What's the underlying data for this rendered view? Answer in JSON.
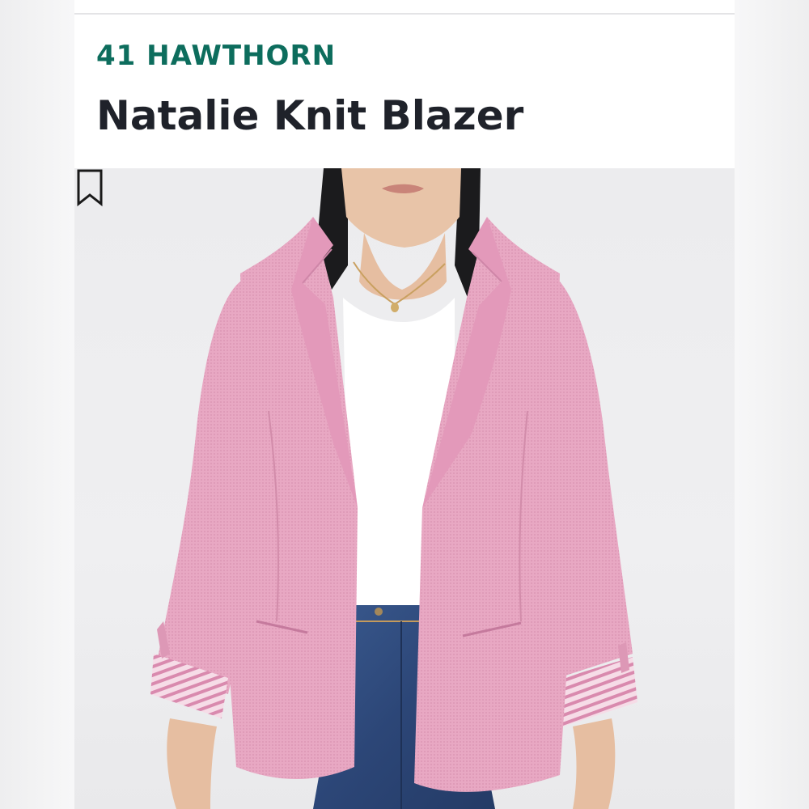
{
  "product": {
    "brand": "41 HAWTHORN",
    "name": "Natalie Knit Blazer"
  },
  "image": {
    "bookmark_icon": "bookmark-icon",
    "colors": {
      "blazer": "#e7a6c1",
      "shirt": "#ffffff",
      "jeans": "#2f4a7a",
      "hair": "#1b1b1d",
      "skin": "#e6c1a5",
      "background": "#ececee"
    }
  },
  "colors": {
    "brand": "#0d6d5d",
    "title": "#1f222a"
  }
}
